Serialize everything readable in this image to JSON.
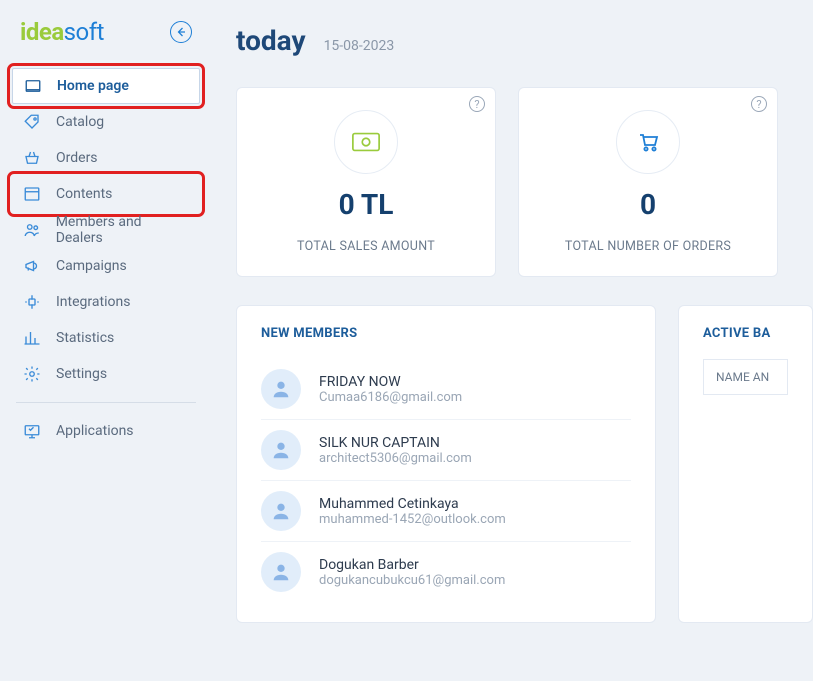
{
  "brand": {
    "part1": "idea",
    "part2": "soft"
  },
  "sidebar": {
    "items": [
      {
        "label": "Home page"
      },
      {
        "label": "Catalog"
      },
      {
        "label": "Orders"
      },
      {
        "label": "Contents"
      },
      {
        "label": "Members and Dealers"
      },
      {
        "label": "Campaigns"
      },
      {
        "label": "Integrations"
      },
      {
        "label": "Statistics"
      },
      {
        "label": "Settings"
      },
      {
        "label": "Applications"
      }
    ]
  },
  "header": {
    "title": "today",
    "date": "15-08-2023"
  },
  "stats": {
    "sales": {
      "value": "0 TL",
      "label": "TOTAL SALES AMOUNT"
    },
    "orders": {
      "value": "0",
      "label": "TOTAL NUMBER OF ORDERS"
    }
  },
  "members_panel": {
    "title": "NEW MEMBERS",
    "rows": [
      {
        "name": "FRIDAY NOW",
        "email": "Cumaa6186@gmail.com"
      },
      {
        "name": "SILK NUR CAPTAIN",
        "email": "architect5306@gmail.com"
      },
      {
        "name": "Muhammed Cetinkaya",
        "email": "muhammed-1452@outlook.com"
      },
      {
        "name": "Dogukan Barber",
        "email": "dogukancubukcu61@gmail.com"
      }
    ]
  },
  "active_panel": {
    "title": "ACTIVE BA",
    "col0": "NAME AN"
  }
}
